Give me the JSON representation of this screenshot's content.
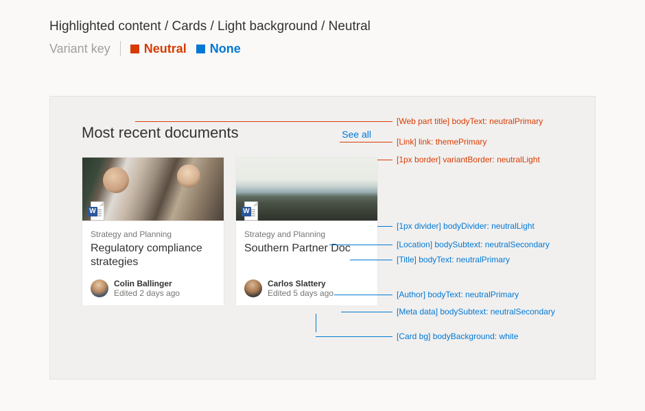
{
  "breadcrumb": "Highlighted content / Cards / Light background / Neutral",
  "variant_key_label": "Variant key",
  "variants": {
    "neutral": "Neutral",
    "none": "None"
  },
  "webpart": {
    "title": "Most recent documents",
    "see_all": "See all"
  },
  "cards": [
    {
      "location": "Strategy and Planning",
      "title": "Regulatory compliance strategies",
      "author": "Colin Ballinger",
      "meta": "Edited 2 days ago",
      "doc_glyph": "W"
    },
    {
      "location": "Strategy and Planning",
      "title": "Southern Partner Doc",
      "author": "Carlos Slattery",
      "meta": "Edited 5 days ago",
      "doc_glyph": "W"
    }
  ],
  "annotations": {
    "webpart_title": "[Web part title] bodyText: neutralPrimary",
    "link": "[Link] link: themePrimary",
    "border": "[1px border] variantBorder: neutralLight",
    "divider": "[1px divider] bodyDivider: neutralLight",
    "location": "[Location] bodySubtext: neutralSecondary",
    "title": "[Title] bodyText: neutralPrimary",
    "author": "[Author] bodyText: neutralPrimary",
    "meta": "[Meta data] bodySubtext: neutralSecondary",
    "card_bg": "[Card bg] bodyBackground: white"
  },
  "colors": {
    "neutralPrimary": "#323130",
    "neutralSecondary": "#767573",
    "neutralLight": "#eae9e7",
    "themePrimary": "#0078d4",
    "variant_red": "#d83b01",
    "white": "#ffffff"
  }
}
